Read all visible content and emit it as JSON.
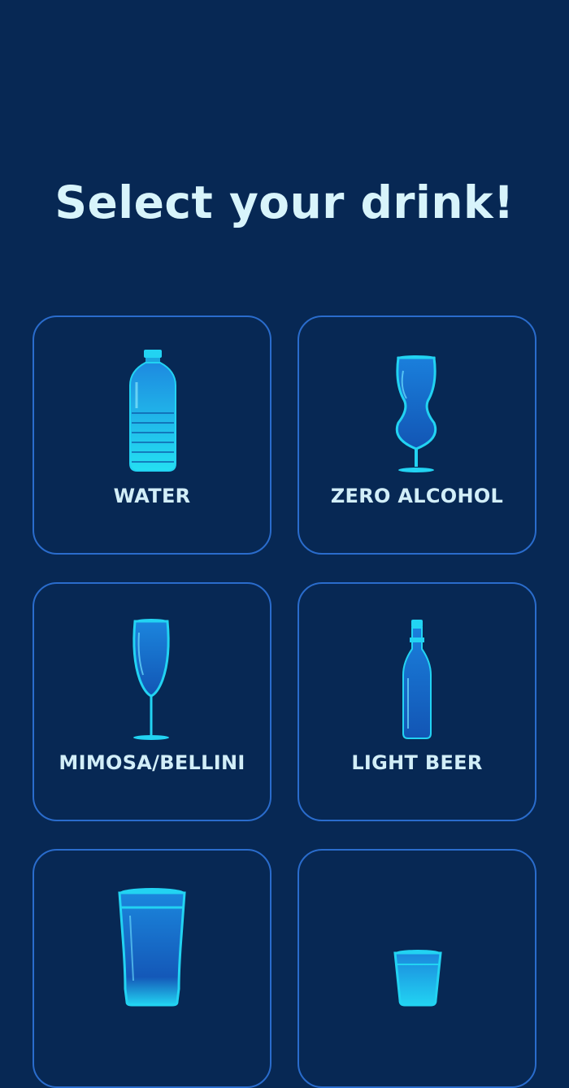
{
  "page": {
    "title": "Select your drink!"
  },
  "drinks": [
    {
      "label": "WATER",
      "icon": "water-bottle-icon"
    },
    {
      "label": "ZERO ALCOHOL",
      "icon": "hurricane-glass-icon"
    },
    {
      "label": "MIMOSA/BELLINI",
      "icon": "champagne-flute-icon"
    },
    {
      "label": "LIGHT BEER",
      "icon": "beer-bottle-icon"
    },
    {
      "label": "",
      "icon": "pint-glass-icon"
    },
    {
      "label": "",
      "icon": "shot-glass-icon"
    }
  ],
  "colors": {
    "background": "#072854",
    "card_border": "#2a6ccc",
    "title_text": "#d8f4fb",
    "icon_cyan": "#22d3f2",
    "icon_blue": "#1566c8"
  }
}
